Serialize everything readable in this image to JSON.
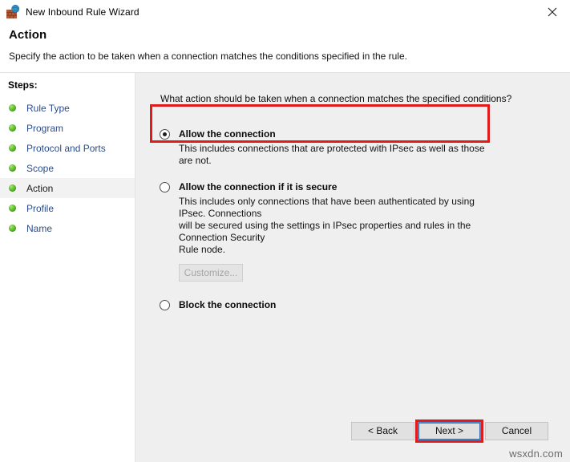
{
  "window": {
    "title": "New Inbound Rule Wizard",
    "icon": "firewall-globe-icon",
    "close_label": "✕"
  },
  "header": {
    "title": "Action",
    "subtitle": "Specify the action to be taken when a connection matches the conditions specified in the rule."
  },
  "sidebar": {
    "title": "Steps:",
    "items": [
      {
        "label": "Rule Type",
        "current": false
      },
      {
        "label": "Program",
        "current": false
      },
      {
        "label": "Protocol and Ports",
        "current": false
      },
      {
        "label": "Scope",
        "current": false
      },
      {
        "label": "Action",
        "current": true
      },
      {
        "label": "Profile",
        "current": false
      },
      {
        "label": "Name",
        "current": false
      }
    ]
  },
  "main": {
    "question": "What action should be taken when a connection matches the specified conditions?",
    "options": [
      {
        "id": "allow",
        "title": "Allow the connection",
        "selected": true,
        "desc_lines": [
          "This includes connections that are protected with IPsec as well as those are not."
        ],
        "highlighted": true
      },
      {
        "id": "allow-secure",
        "title": "Allow the connection if it is secure",
        "selected": false,
        "desc_lines": [
          "This includes only connections that have been authenticated by using IPsec.  Connections",
          "will be secured using the settings in IPsec properties and rules in the Connection Security",
          "Rule node."
        ],
        "highlighted": false,
        "customize_label": "Customize...",
        "customize_disabled": true
      },
      {
        "id": "block",
        "title": "Block the connection",
        "selected": false,
        "desc_lines": [],
        "highlighted": false
      }
    ]
  },
  "footer": {
    "back_label": "< Back",
    "next_label": "Next >",
    "cancel_label": "Cancel",
    "next_highlighted": true
  },
  "watermark": "wsxdn.com",
  "colors": {
    "annotation": "#e01b1b",
    "panel_bg": "#efefef",
    "link_text": "#2a4b8d",
    "focus_border": "#2f6fb5"
  }
}
